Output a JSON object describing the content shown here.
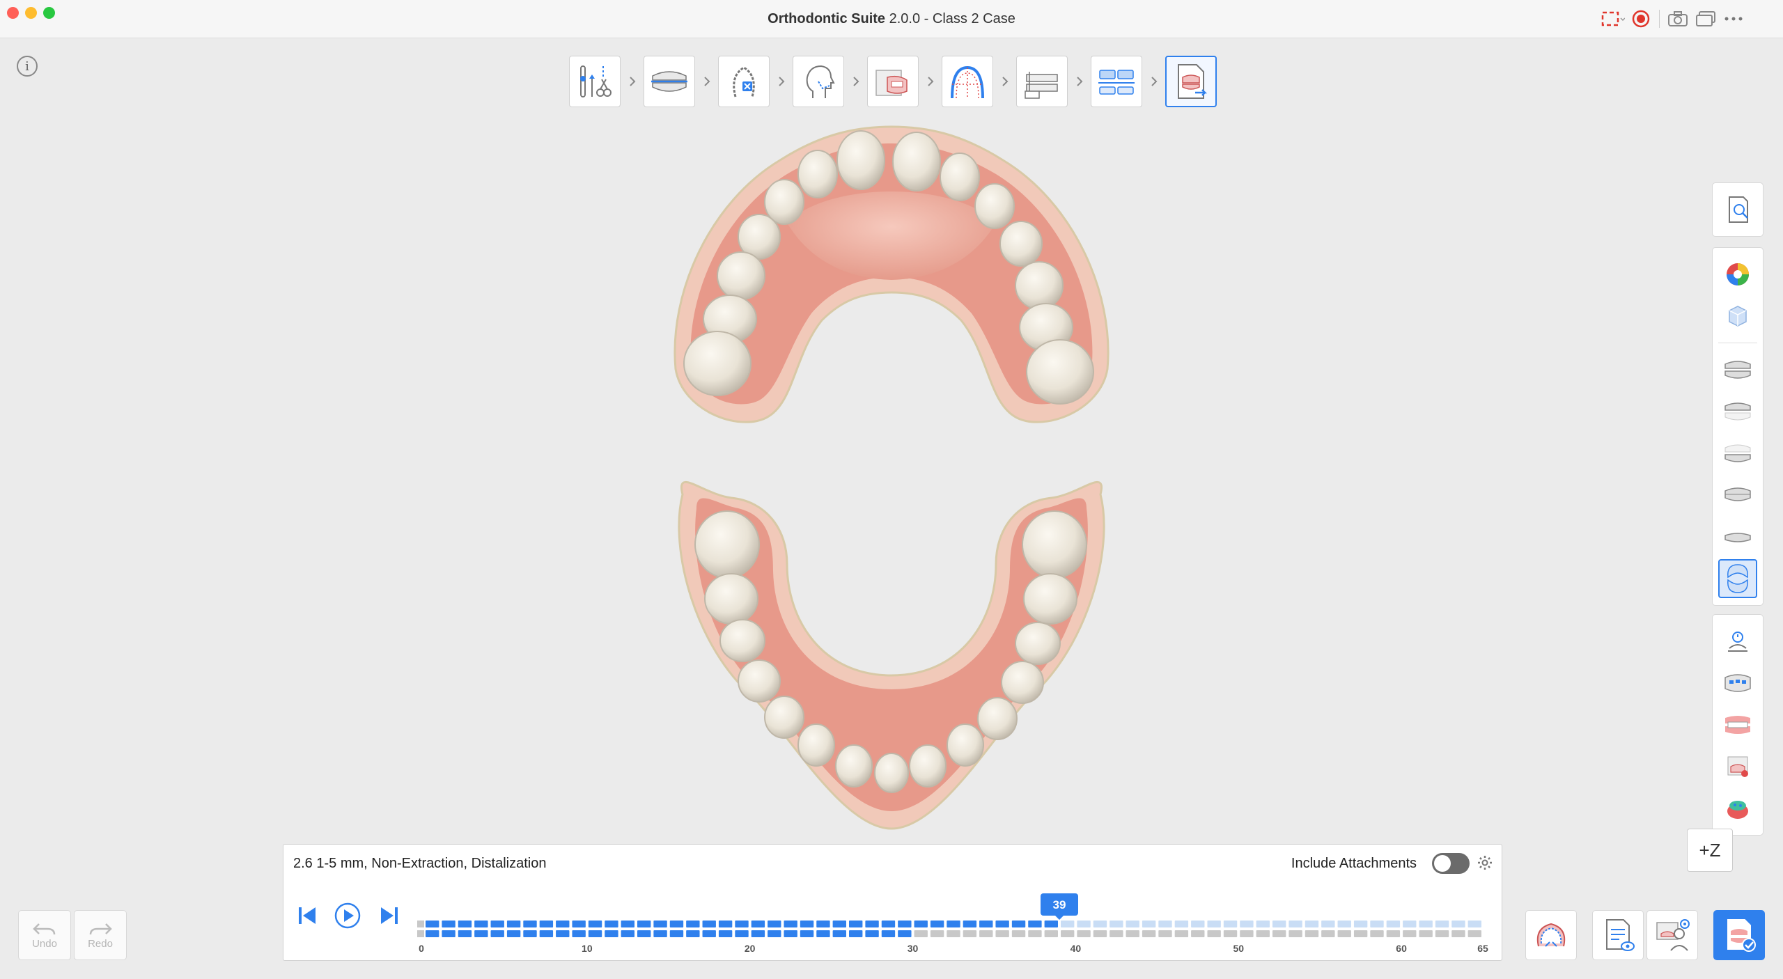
{
  "window": {
    "app_name": "Orthodontic Suite",
    "title_rest": "2.0.0 - Class 2 Case"
  },
  "workflow_steps": [
    {
      "name": "segmentation-tools-step",
      "active": false
    },
    {
      "name": "occlusion-step",
      "active": false
    },
    {
      "name": "tooth-setup-step",
      "active": false
    },
    {
      "name": "face-profile-step",
      "active": false
    },
    {
      "name": "xray-overlay-step",
      "active": false
    },
    {
      "name": "arch-form-step",
      "active": false
    },
    {
      "name": "model-setup-step",
      "active": false
    },
    {
      "name": "staging-step",
      "active": false
    },
    {
      "name": "report-export-step",
      "active": true
    }
  ],
  "info_icon_glyph": "i",
  "sidebar": {
    "group1": [
      "tooth-report-icon"
    ],
    "group2_top": [
      "color-map-icon",
      "transparency-cube-icon"
    ],
    "group2_views": [
      "view-both-jaws-icon",
      "view-upper-jaw-icon",
      "view-lower-jaw-icon",
      "view-front-icon",
      "view-side-icon",
      "view-occlusal-icon"
    ],
    "group3": [
      "bite-ramp-icon",
      "attachments-icon",
      "gingiva-icon",
      "ipr-icon",
      "collision-icon"
    ],
    "active_view_index": 5
  },
  "z_button": "+Z",
  "undo_label": "Undo",
  "redo_label": "Redo",
  "panel": {
    "plan_title": "2.6 1-5 mm, Non-Extraction, Distalization",
    "include_attachments_label": "Include Attachments",
    "include_attachments_on": false
  },
  "timeline": {
    "current_stage": "39",
    "total_stages": 65,
    "upper_stages_done": 39,
    "lower_stages_done": 30,
    "tick_labels": [
      "0",
      "10",
      "20",
      "30",
      "40",
      "50",
      "60",
      "65"
    ]
  },
  "colors": {
    "accent": "#2f80ed",
    "segment_done": "#2f80ed",
    "segment_upper_future": "#c9ddf5",
    "segment_lower_future": "#c8c8c8",
    "gum": "#e89a8a",
    "gum_base": "#f0c3b6",
    "tooth": "#f1ece2"
  }
}
